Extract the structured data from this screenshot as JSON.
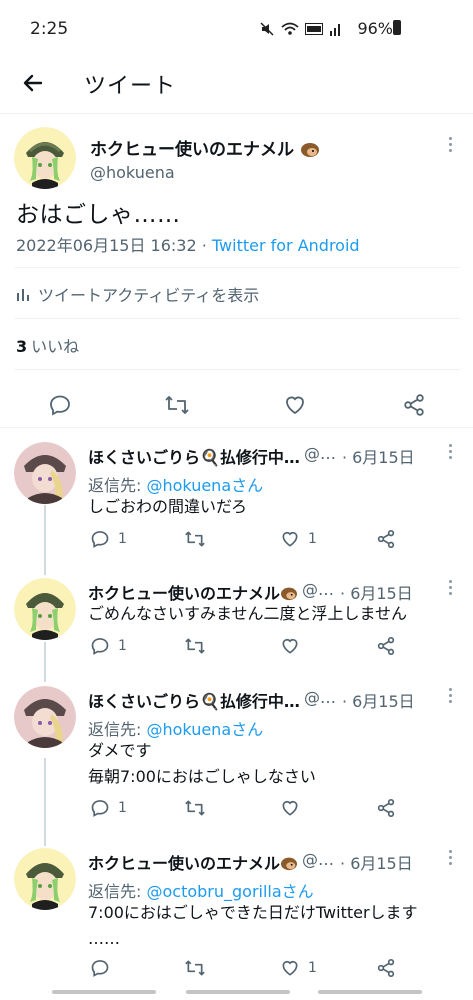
{
  "status": {
    "time": "2:25",
    "battery": "96%"
  },
  "header": {
    "title": "ツイート"
  },
  "main_tweet": {
    "name": "ホクヒュー使いのエナメル",
    "handle": "@hokuena",
    "text": "おはごしゃ……",
    "datetime": "2022年06月15日 16:32 · ",
    "source": "Twitter for Android",
    "activity_label": "ツイートアクティビティを表示",
    "likes_count": "3",
    "likes_label": "いいね"
  },
  "replies": [
    {
      "name": "ほくさいごりら🍳払修行中…",
      "handle": "@…",
      "date": "· 6月15日",
      "reply_to_prefix": "返信先: ",
      "reply_to_handle": "@hokuenaさん",
      "text": "しごおわの間違いだろ",
      "reply_count": "1",
      "retweet_count": "",
      "like_count": "1"
    },
    {
      "name": "ホクヒュー使いのエナメル",
      "handle": "@…",
      "date": "· 6月15日",
      "text": "ごめんなさいすみません二度と浮上しません",
      "reply_count": "1",
      "retweet_count": "",
      "like_count": ""
    },
    {
      "name": "ほくさいごりら🍳払修行中…",
      "handle": "@…",
      "date": "· 6月15日",
      "reply_to_prefix": "返信先: ",
      "reply_to_handle": "@hokuenaさん",
      "text": "ダメです\n毎朝7:00におはごしゃしなさい",
      "reply_count": "1",
      "retweet_count": "",
      "like_count": ""
    },
    {
      "name": "ホクヒュー使いのエナメル",
      "handle": "@…",
      "date": "· 6月15日",
      "reply_to_prefix": "返信先: ",
      "reply_to_handle": "@octobru_gorillaさん",
      "text": "7:00におはごしゃできた日だけTwitterします\n……",
      "reply_count": "",
      "retweet_count": "",
      "like_count": "1"
    }
  ],
  "colors": {
    "accent": "#1d9bf0",
    "secondary_text": "#536471",
    "divider": "#eff3f4"
  }
}
